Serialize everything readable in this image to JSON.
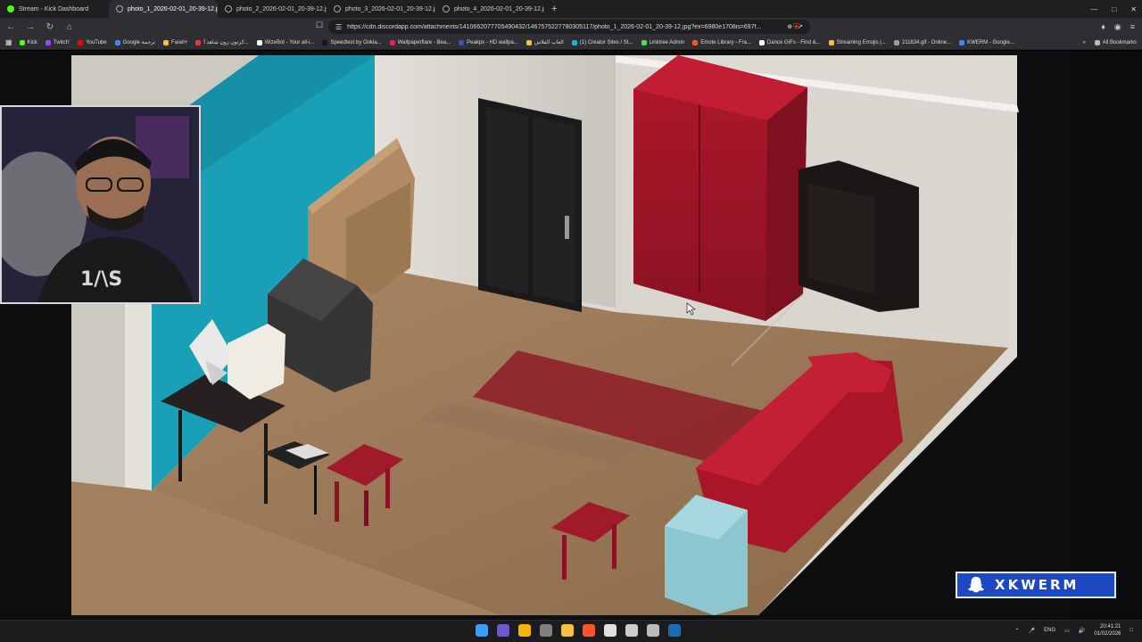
{
  "browser": {
    "tabs": [
      {
        "title": "Stream - Kick Dashboard",
        "active": false
      },
      {
        "title": "photo_1_2026-02-01_20-39-12.jp",
        "active": true
      },
      {
        "title": "photo_2_2026-02-01_20-39-12.jpg (",
        "active": false
      },
      {
        "title": "photo_3_2026-02-01_20-39-12.jpg (",
        "active": false
      },
      {
        "title": "photo_4_2026-02-01_20-39-12.jpg (",
        "active": false
      }
    ],
    "new_tab": "+",
    "url": "https://cdn.discordapp.com/attachments/1410662077705490432/1467575227780305117/photo_1_2026-02-01_20-39-12.jpg?ex=6980e1708is=697f...",
    "bookmarks": [
      {
        "label": "Kick",
        "color": "#53fc18"
      },
      {
        "label": "Twitch'",
        "color": "#9146ff"
      },
      {
        "label": "YouTube",
        "color": "#ff0000"
      },
      {
        "label": "Google ترجمة",
        "color": "#4285f4"
      },
      {
        "label": "Fasel+",
        "color": "#f6c23e"
      },
      {
        "label": "كرتون زون شاهد أ...",
        "color": "#e53935"
      },
      {
        "label": "WizeBot - Your all-i...",
        "color": "#ffffff"
      },
      {
        "label": "Speedtest by Ookla...",
        "color": "#141526"
      },
      {
        "label": "Wallpaperflare - Bea...",
        "color": "#e91e63"
      },
      {
        "label": "Peakpx - HD wallpa...",
        "color": "#3f51b5"
      },
      {
        "label": "العاب الفلاش",
        "color": "#f6c23e"
      },
      {
        "label": "(1) Creator Sites / St...",
        "color": "#00bcd4"
      },
      {
        "label": "Linktree Admin",
        "color": "#43e55e"
      },
      {
        "label": "Emote Library - Fra...",
        "color": "#ff5722"
      },
      {
        "label": "Dance GIFs - Find &...",
        "color": "#ffffff"
      },
      {
        "label": "Streaming Emojis |...",
        "color": "#f6c23e"
      },
      {
        "label": "211834.gif - Online...",
        "color": "#9e9e9e"
      },
      {
        "label": "KWERM - Google...",
        "color": "#4285f4"
      }
    ],
    "more_bookmarks": "»",
    "all_bookmarks": "All Bookmarks"
  },
  "overlay": {
    "brand_name": "XKWERM"
  },
  "taskbar": {
    "icons": [
      {
        "name": "windows-start-icon",
        "color": "#3b9cff"
      },
      {
        "name": "search-app-icon",
        "color": "#6a5acd"
      },
      {
        "name": "chrome-icon",
        "color": "#f4b400"
      },
      {
        "name": "app-icon",
        "color": "#808080"
      },
      {
        "name": "file-explorer-icon",
        "color": "#f6c23e"
      },
      {
        "name": "brave-icon",
        "color": "#fb542b"
      },
      {
        "name": "app-dark-icon",
        "color": "#e0e0e0"
      },
      {
        "name": "obs-icon",
        "color": "#cccccc"
      },
      {
        "name": "settings-icon",
        "color": "#bbbbbb"
      },
      {
        "name": "steam-icon",
        "color": "#1b6fb0"
      }
    ],
    "language": "ENG",
    "time": "20:41:21",
    "date": "01/02/2026"
  }
}
